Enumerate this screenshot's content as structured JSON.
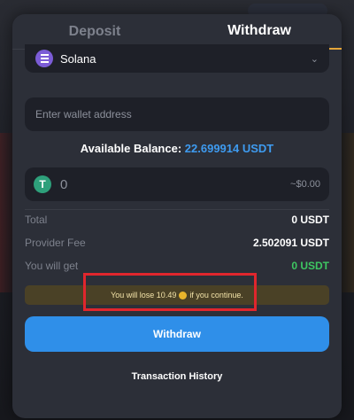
{
  "tabs": [
    {
      "label": "Deposit",
      "active": false
    },
    {
      "label": "Withdraw",
      "active": true
    }
  ],
  "network": {
    "selected": "Solana",
    "icon": "solana-icon"
  },
  "wallet": {
    "placeholder": "Enter wallet address",
    "value": ""
  },
  "balance": {
    "label": "Available Balance:",
    "value": "22.699914 USDT"
  },
  "amount": {
    "value": "0",
    "usd_value": "~$0.00",
    "icon": "tether-icon"
  },
  "summary": {
    "total_label": "Total",
    "total_value": "0 USDT",
    "fee_label": "Provider Fee",
    "fee_value": "2.502091 USDT",
    "get_label": "You will get",
    "get_value": "0 USDT"
  },
  "warning": {
    "prefix": "You will lose 10.49",
    "suffix": "if you continue.",
    "icon": "coin-icon"
  },
  "actions": {
    "withdraw_label": "Withdraw",
    "history_label": "Transaction History"
  },
  "colors": {
    "accent_blue": "#2f8fe9",
    "balance_blue": "#3e9bf0",
    "green": "#3ec762",
    "tab_underline": "#e5a53a",
    "warning_bg": "#4a4126",
    "highlight_red": "#e0262d"
  }
}
